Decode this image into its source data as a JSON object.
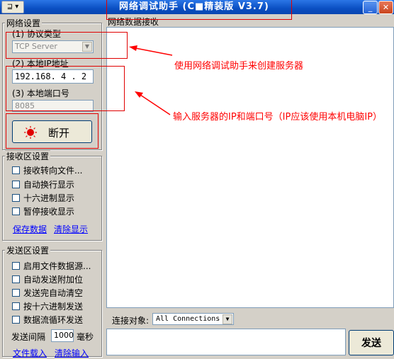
{
  "window": {
    "title": "网络调试助手 (C■精装版 V3.7)",
    "sysmenu": "⊒ ▾",
    "minimize": "_",
    "close": "✕"
  },
  "network_settings": {
    "group_label": "网络设置",
    "protocol_label": "(1) 协议类型",
    "protocol_value": "TCP Server",
    "ip_label": "(2) 本地IP地址",
    "ip_value": "192.168. 4 . 2",
    "port_label": "(3) 本地端口号",
    "port_value": "8085",
    "toggle_button": "断开"
  },
  "receive_settings": {
    "group_label": "接收区设置",
    "options": [
      "接收转向文件...",
      "自动换行显示",
      "十六进制显示",
      "暂停接收显示"
    ],
    "save_link": "保存数据",
    "clear_link": "清除显示"
  },
  "send_settings": {
    "group_label": "发送区设置",
    "options": [
      "启用文件数据源...",
      "自动发送附加位",
      "发送完自动清空",
      "按十六进制发送",
      "数据流循环发送"
    ],
    "interval_label": "发送间隔",
    "interval_value": "1000",
    "interval_unit": "毫秒",
    "file_link": "文件载入",
    "clear_input_link": "清除输入"
  },
  "receive_area": {
    "label": "网络数据接收"
  },
  "connection": {
    "label": "连接对象:",
    "value": "All Connections"
  },
  "send_button": "发送",
  "annotations": {
    "note1": "使用网络调试助手来创建服务器",
    "note2": "输入服务器的IP和端口号（IP应该使用本机电脑IP）"
  },
  "colors": {
    "titlebar": "#0a4fc2",
    "annotation": "#ff0000",
    "link": "#0000ff",
    "indicator": "#e00000"
  }
}
